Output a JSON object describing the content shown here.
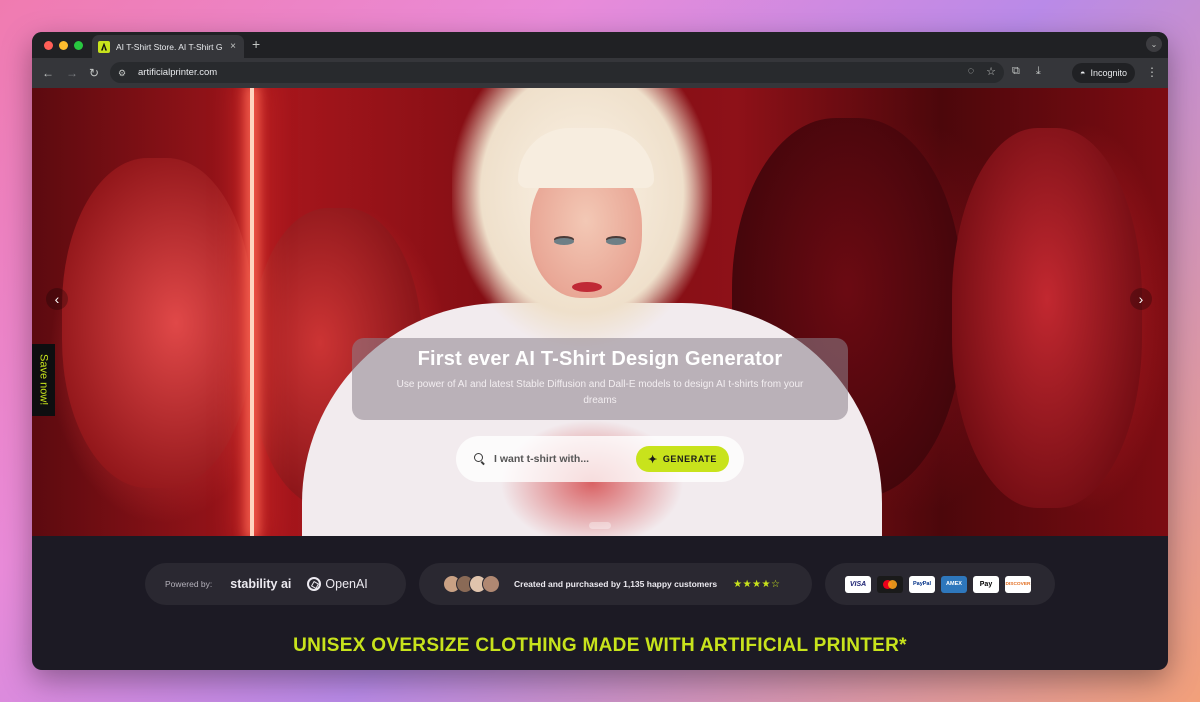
{
  "browser": {
    "tab_title": "AI T-Shirt Store. AI T-Shirt Ge",
    "tab_close": "×",
    "new_tab": "+",
    "url": "artificialprinter.com",
    "incognito_label": "Incognito"
  },
  "hero": {
    "title": "First ever AI T-Shirt Design Generator",
    "subtitle": "Use power of AI and latest Stable Diffusion and Dall-E models to design AI t-shirts from your dreams",
    "search_placeholder": "I want t-shirt with...",
    "generate_label": "GENERATE",
    "save_now": "Save now!"
  },
  "trust": {
    "powered_by": "Powered by:",
    "stability": "stability ai",
    "openai": "OpenAI",
    "customers": "Created and purchased by 1,135 happy customers",
    "stars": "★★★★☆",
    "rating": 4.5,
    "cards": {
      "visa": "VISA",
      "paypal": "PayPal",
      "amex": "AMEX",
      "apple": "Pay",
      "discover": "DISCOVER"
    }
  },
  "tagline": "UNISEX OVERSIZE CLOTHING MADE WITH ARTIFICIAL PRINTER*",
  "colors": {
    "accent": "#c8e31c",
    "page_bg": "#1c1a24",
    "pill_bg": "#2a2831"
  },
  "icons": {
    "back": "arrow-left-icon",
    "forward": "arrow-right-icon",
    "reload": "reload-icon",
    "search": "search-icon",
    "wand": "magic-wand-icon"
  }
}
